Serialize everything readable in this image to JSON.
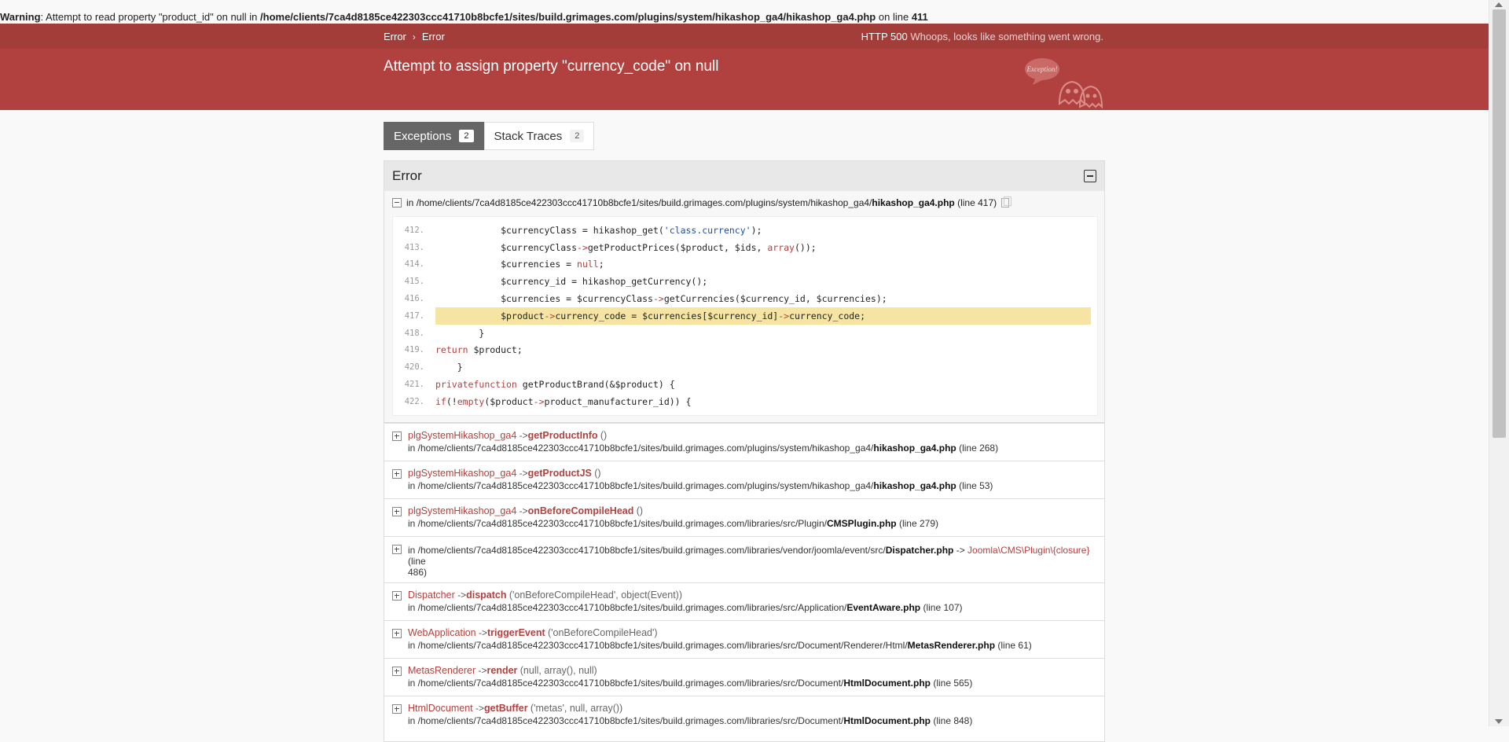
{
  "warning": {
    "label": "Warning",
    "message_pre": ": Attempt to read property \"product_id\" on null in ",
    "path": "/home/clients/7ca4d8185ce422303ccc41710b8bcfe1/sites/build.grimages.com/plugins/system/hikashop_ga4/hikashop_ga4.php",
    "message_mid": " on line ",
    "line": "411"
  },
  "header": {
    "crumbs": [
      "Error",
      "Error"
    ],
    "http_code": "HTTP 500",
    "http_message": "Whoops, looks like something went wrong.",
    "title": "Attempt to assign property \"currency_code\" on null",
    "ghost_text": "Exception!"
  },
  "tabs": [
    {
      "label": "Exceptions",
      "count": "2"
    },
    {
      "label": "Stack Traces",
      "count": "2"
    }
  ],
  "panel": {
    "title": "Error",
    "main_trace": {
      "prefix": "in ",
      "path": "/home/clients/7ca4d8185ce422303ccc41710b8bcfe1/sites/build.grimages.com/plugins/system/hikashop_ga4/",
      "file": "hikashop_ga4.php",
      "suffix": " (line 417)"
    },
    "code": [
      {
        "ln": "412.",
        "src": "            $currencyClass = hikashop_get('class.currency');"
      },
      {
        "ln": "413.",
        "src": "            $currencyClass->getProductPrices($product, $ids, array());"
      },
      {
        "ln": "414.",
        "src": "            $currencies = null;"
      },
      {
        "ln": "415.",
        "src": "            $currency_id = hikashop_getCurrency();"
      },
      {
        "ln": "416.",
        "src": "            $currencies = $currencyClass->getCurrencies($currency_id, $currencies);"
      },
      {
        "ln": "417.",
        "src": "            $product->currency_code = $currencies[$currency_id]->currency_code;"
      },
      {
        "ln": "418.",
        "src": "        }"
      },
      {
        "ln": "419.",
        "src": "        return $product;"
      },
      {
        "ln": "420.",
        "src": "    }"
      },
      {
        "ln": "421.",
        "src": "    private function getProductBrand(&$product) {"
      },
      {
        "ln": "422.",
        "src": "        if(!empty($product->product_manufacturer_id)) {"
      }
    ],
    "frames": [
      {
        "cls": "plgSystemHikashop_ga4",
        "meth": "getProductInfo",
        "args": "()",
        "path": "in /home/clients/7ca4d8185ce422303ccc41710b8bcfe1/sites/build.grimages.com/plugins/system/hikashop_ga4/",
        "file": "hikashop_ga4.php",
        "line": " (line 268)"
      },
      {
        "cls": "plgSystemHikashop_ga4",
        "meth": "getProductJS",
        "args": "()",
        "path": "in /home/clients/7ca4d8185ce422303ccc41710b8bcfe1/sites/build.grimages.com/plugins/system/hikashop_ga4/",
        "file": "hikashop_ga4.php",
        "line": " (line 53)"
      },
      {
        "cls": "plgSystemHikashop_ga4",
        "meth": "onBeforeCompileHead",
        "args": "()",
        "path": "in /home/clients/7ca4d8185ce422303ccc41710b8bcfe1/sites/build.grimages.com/libraries/src/Plugin/",
        "file": "CMSPlugin.php",
        "line": " (line 279)"
      },
      {
        "closure_frame": true,
        "path": "in /home/clients/7ca4d8185ce422303ccc41710b8bcfe1/sites/build.grimages.com/libraries/vendor/joomla/event/src/",
        "file": "Dispatcher.php",
        "arrow": " -> ",
        "closure": "Joomla\\CMS\\Plugin\\{closure}",
        "line1": " (line",
        "line2": "486)"
      },
      {
        "cls": "Dispatcher",
        "meth": "dispatch",
        "args": "('onBeforeCompileHead', object(Event))",
        "path": "in /home/clients/7ca4d8185ce422303ccc41710b8bcfe1/sites/build.grimages.com/libraries/src/Application/",
        "file": "EventAware.php",
        "line": " (line 107)"
      },
      {
        "cls": "WebApplication",
        "meth": "triggerEvent",
        "args": "('onBeforeCompileHead')",
        "path": "in /home/clients/7ca4d8185ce422303ccc41710b8bcfe1/sites/build.grimages.com/libraries/src/Document/Renderer/Html/",
        "file": "MetasRenderer.php",
        "line": " (line 61)"
      },
      {
        "cls": "MetasRenderer",
        "meth": "render",
        "args": "(null, array(), null)",
        "path": "in /home/clients/7ca4d8185ce422303ccc41710b8bcfe1/sites/build.grimages.com/libraries/src/Document/",
        "file": "HtmlDocument.php",
        "line": " (line 565)"
      },
      {
        "cls": "HtmlDocument",
        "meth": "getBuffer",
        "args": "('metas', null, array())",
        "path": "in /home/clients/7ca4d8185ce422303ccc41710b8bcfe1/sites/build.grimages.com/libraries/src/Document/",
        "file": "HtmlDocument.php",
        "line": " (line 848)"
      }
    ]
  }
}
